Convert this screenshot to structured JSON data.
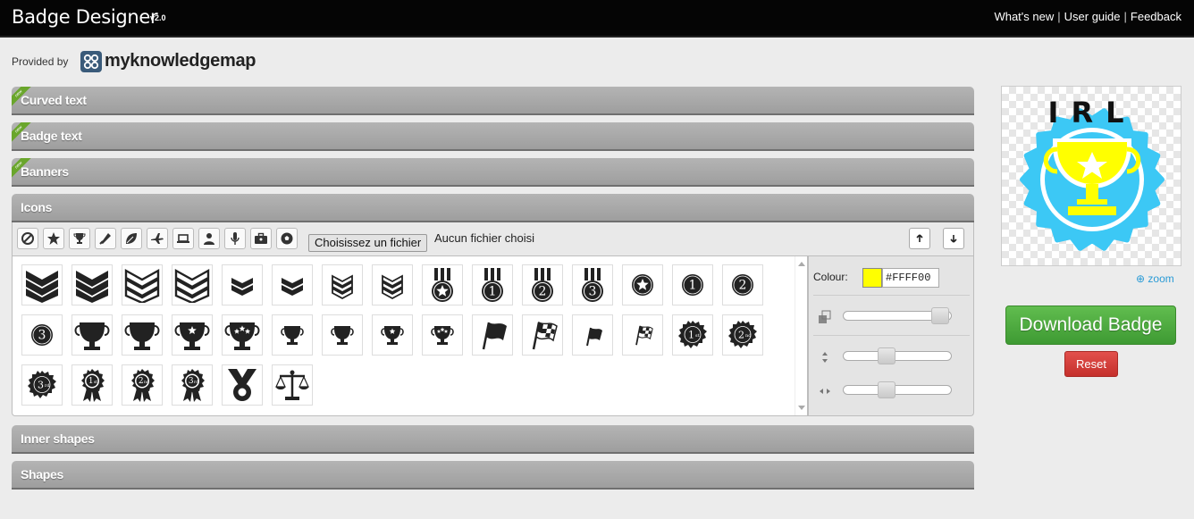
{
  "app": {
    "title": "Badge Designer",
    "version": "v2.0"
  },
  "nav": {
    "whats_new": "What's new",
    "user_guide": "User guide",
    "feedback": "Feedback",
    "separator": "|"
  },
  "provider": {
    "label": "Provided by",
    "name": "myknowledgemap"
  },
  "panels": {
    "curved_text": "Curved text",
    "badge_text": "Badge text",
    "banners": "Banners",
    "icons": "Icons",
    "inner_shapes": "Inner shapes",
    "shapes": "Shapes",
    "ribbon_text": "new"
  },
  "icons_toolbar": {
    "categories": [
      "none-icon",
      "star-icon",
      "trophy-icon",
      "ribbon-icon",
      "leaf-icon",
      "plane-icon",
      "laptop-icon",
      "person-icon",
      "microphone-icon",
      "briefcase-icon",
      "ball-icon"
    ],
    "file_button": "Choisissez un fichier",
    "file_status": "Aucun fichier choisi"
  },
  "icon_grid": [
    "chevron-3-large",
    "chevron-3-large-b",
    "chevron-3-outline",
    "chevron-3-outline-b",
    "chevron-2-small",
    "chevron-2-small-b",
    "chevron-3-small",
    "chevron-3-small-b",
    "medal-star",
    "medal-1",
    "medal-2",
    "medal-3",
    "circle-star",
    "circle-1",
    "circle-2",
    "circle-3",
    "trophy-large",
    "trophy-large-b",
    "trophy-star",
    "trophy-stars",
    "trophy-small",
    "trophy-small-b",
    "trophy-small-star",
    "trophy-small-stars",
    "flag-large",
    "flag-checkered-large",
    "flag-small",
    "flag-checkered-small",
    "seal-1st",
    "seal-2nd",
    "seal-3rd",
    "rosette-1st",
    "rosette-2nd",
    "rosette-3rd",
    "medal-ring",
    "scales"
  ],
  "properties": {
    "colour_label": "Colour:",
    "colour_value": "#FFFF00",
    "opacity": 0.98,
    "vertical": 0.38,
    "horizontal": 0.38
  },
  "preview": {
    "badge_text": "IRL",
    "badge_color": "#3cc8f5",
    "icon_color": "#FFFF00",
    "text_color": "#111111"
  },
  "actions": {
    "zoom": "zoom",
    "download": "Download Badge",
    "reset": "Reset"
  }
}
